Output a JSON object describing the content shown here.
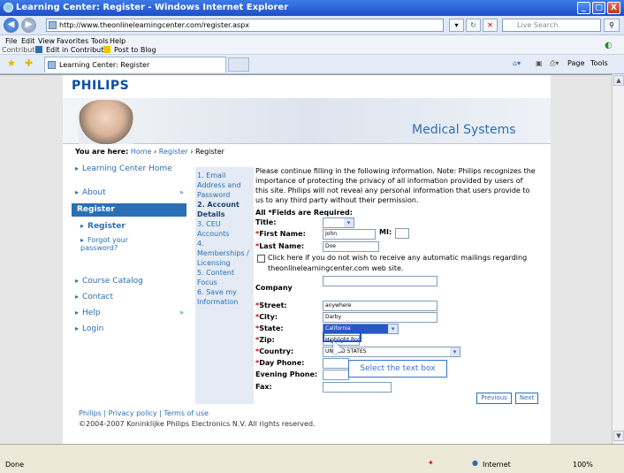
{
  "window": {
    "title": "Learning Center: Register - Windows Internet Explorer",
    "min": "_",
    "max": "□",
    "close": "X"
  },
  "address": {
    "url": "http://www.theonlinelearningcenter.com/register.aspx",
    "search_placeholder": "Live Search"
  },
  "menu": {
    "items": [
      "File",
      "Edit",
      "View",
      "Favorites",
      "Tools",
      "Help"
    ],
    "contribute": "Contribute",
    "edit_in_contribute": "Edit in Contribute",
    "post_to_blog": "Post to Blog"
  },
  "tab": {
    "label": "Learning Center: Register",
    "page_label": "Page",
    "tools_label": "Tools"
  },
  "page": {
    "logo": "PHILIPS",
    "banner_text": "Medical Systems",
    "breadcrumb": {
      "lead": "You are here:",
      "home": "Home",
      "register": "Register",
      "current": "Register"
    },
    "nav": {
      "learning_center_home": "Learning Center Home",
      "about": "About",
      "register": "Register",
      "register_sub": "Register",
      "forgot": "Forgot your password?",
      "course_catalog": "Course Catalog",
      "contact": "Contact",
      "help": "Help",
      "login": "Login",
      "expand": "»"
    },
    "steps": {
      "s1": "1. Email Address and Password",
      "s2": "2. Account Details",
      "s3": "3. CEU Accounts",
      "s4": "4. Memberships / Licensing",
      "s5": "5. Content Focus",
      "s6": "6. Save my Information"
    },
    "intro": "Please continue filling in the following information. Note: Philips recognizes the importance of protecting the privacy of all information provided by users of this site. Philips will not reveal any personal information that users provide to us to any third party without their permission.",
    "required_note": "All *Fields are Required:",
    "labels": {
      "title": "Title:",
      "first_name": "First Name:",
      "mi": "MI:",
      "last_name": "Last Name:",
      "mailings": "Click here if you do not wish to receive any automatic mailings regarding theonlinelearningcenter.com web site.",
      "company": "Company",
      "street": "Street:",
      "city": "City:",
      "state": "State:",
      "zip": "Zip:",
      "country": "Country:",
      "day_phone": "Day Phone:",
      "evening_phone": "Evening Phone:",
      "fax": "Fax:"
    },
    "values": {
      "first_name": "John",
      "last_name": "Doe",
      "street": "anywhere",
      "city": "Darby",
      "state": "California",
      "zip": "Highlight Box",
      "country": "UNITED STATES"
    },
    "buttons": {
      "previous": "Previous",
      "next": "Next"
    },
    "callout": "Select the text box",
    "footer_links": "Philips | Privacy policy | Terms of use",
    "copyright": "©2004-2007 Koninklijke Philips Electronics N.V. All rights reserved."
  },
  "status": {
    "left": "Done",
    "zone": "Internet",
    "zoom": "100%"
  }
}
